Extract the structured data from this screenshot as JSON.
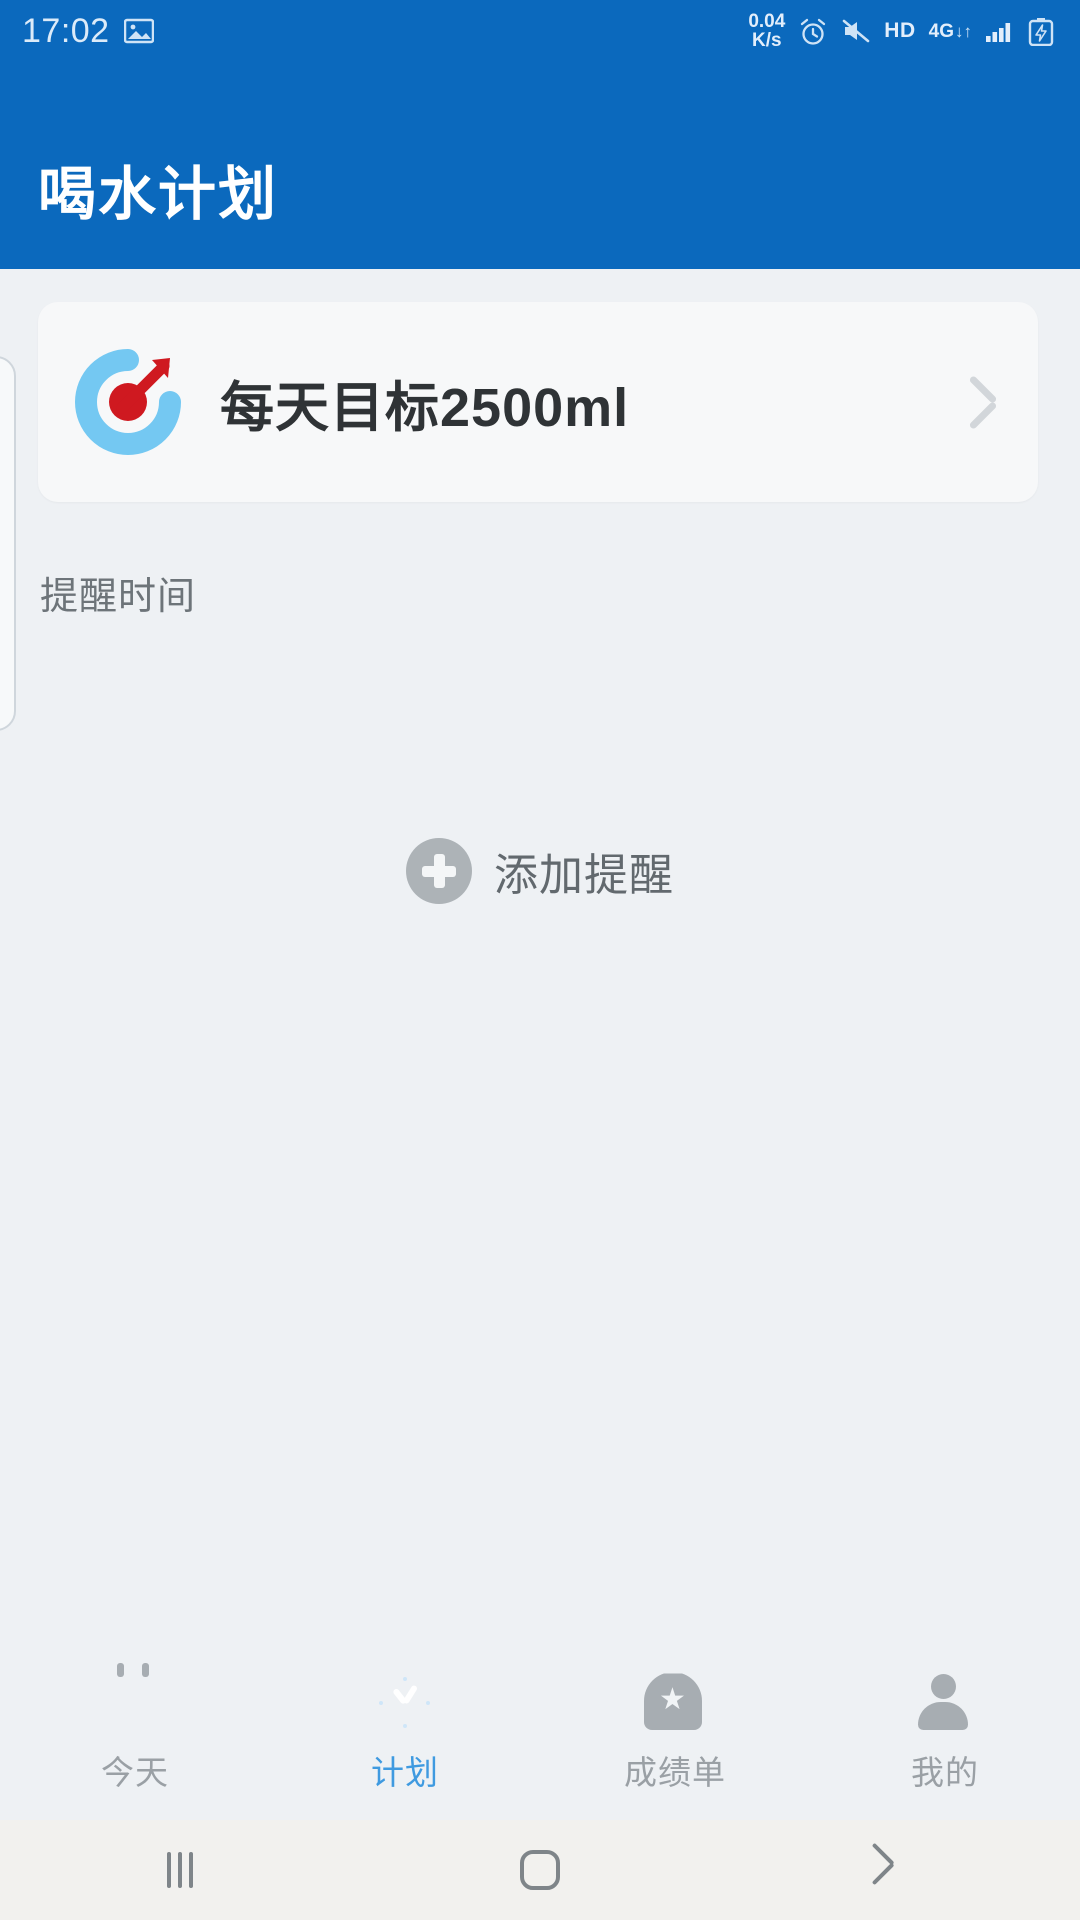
{
  "statusbar": {
    "time": "17:02",
    "gallery_icon": "image-icon",
    "network_speed_value": "0.04",
    "network_speed_unit": "K/s",
    "alarm_icon": "alarm-clock-icon",
    "mute_icon": "volume-muted-icon",
    "hd_label": "HD",
    "network_type": "4G",
    "data_arrows": "↓↑",
    "signal_icon": "signal-bars-icon",
    "battery_icon": "battery-charging-icon",
    "background_color": "#0b69bd"
  },
  "header": {
    "title": "喝水计划",
    "background_color": "#0b69bd",
    "text_color": "#ffffff"
  },
  "goal_card": {
    "icon": "target-dart-icon",
    "label": "每天目标2500ml",
    "chevron": "chevron-right-icon",
    "background_color": "#f7f8f9"
  },
  "reminder_section": {
    "label": "提醒时间",
    "add_button": {
      "icon": "plus-circle-icon",
      "label": "添加提醒"
    }
  },
  "tabbar": {
    "active_color": "#3f9ae0",
    "inactive_color": "#9aa0a5",
    "items": [
      {
        "label": "今天",
        "icon": "calendar-icon",
        "active": false
      },
      {
        "label": "计划",
        "icon": "clock-icon",
        "active": true
      },
      {
        "label": "成绩单",
        "icon": "badge-star-icon",
        "active": false
      },
      {
        "label": "我的",
        "icon": "person-icon",
        "active": false
      }
    ]
  },
  "navbar": {
    "recents": "recents-icon",
    "home": "home-icon",
    "back": "back-icon"
  }
}
